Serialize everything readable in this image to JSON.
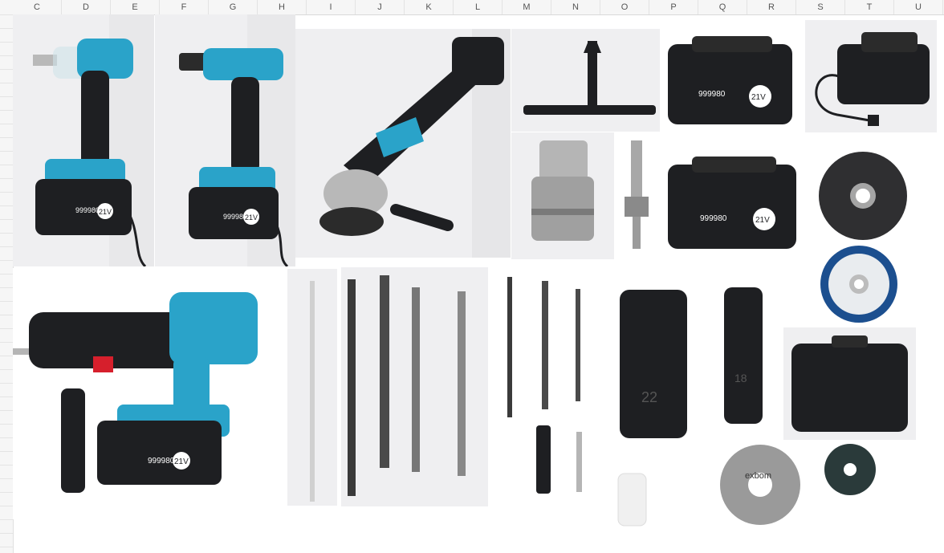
{
  "sheet": {
    "columns": [
      "C",
      "D",
      "E",
      "F",
      "G",
      "H",
      "I",
      "J",
      "K",
      "L",
      "M",
      "N",
      "O",
      "P",
      "Q",
      "R",
      "S",
      "T",
      "U"
    ],
    "accent_teal": "#2aa3c9",
    "tool_black": "#1e1f22"
  },
  "images": {
    "impact_wrench": {
      "label": "impact-wrench-image",
      "battery_text": "999980",
      "volt": "21V"
    },
    "drill": {
      "label": "cordless-drill-image",
      "battery_text": "999980",
      "volt": "21V"
    },
    "grinder": {
      "label": "angle-grinder-image"
    },
    "chuck_key": {
      "label": "chuck-key-image"
    },
    "battery1": {
      "label": "battery-image",
      "battery_text": "999980",
      "volt": "21V"
    },
    "charger": {
      "label": "charger-image"
    },
    "chuck": {
      "label": "drill-chuck-image"
    },
    "adapter": {
      "label": "chuck-adapter-image"
    },
    "battery2": {
      "label": "battery-image",
      "battery_text": "999980",
      "volt": "21V"
    },
    "grinding_disc": {
      "label": "grinding-disc-image"
    },
    "cutting_disc_label": {
      "label": "cutting-disc-image"
    },
    "hammer_drill": {
      "label": "rotary-hammer-image",
      "battery_text": "999980",
      "volt": "21V"
    },
    "blade_text": "exbom",
    "socket_22": "22",
    "socket_18": "18"
  }
}
